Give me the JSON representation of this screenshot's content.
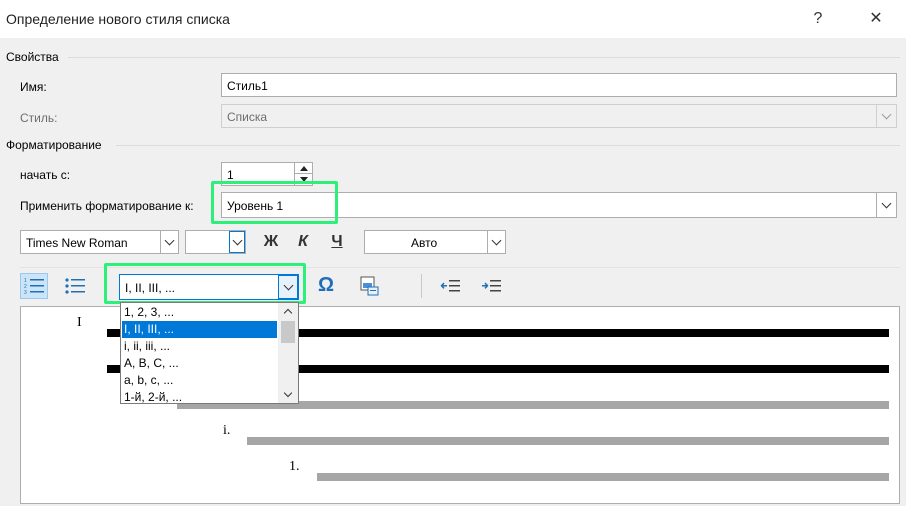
{
  "window": {
    "title": "Определение нового стиля списка",
    "help_label": "?",
    "close_label": "✕"
  },
  "properties": {
    "group_label": "Свойства",
    "name_label": "Имя:",
    "name_value": "Стиль1",
    "style_label": "Стиль:",
    "style_value": "Списка"
  },
  "formatting": {
    "group_label": "Форматирование",
    "start_label": "начать с:",
    "start_value": "1",
    "apply_label": "Применить форматирование к:",
    "apply_value": "Уровень 1",
    "font_name": "Times New Roman",
    "font_size": "",
    "bold_label": "Ж",
    "italic_label": "К",
    "underline_label": "Ч",
    "color_value": "Авто",
    "number_format_value": "I, II, III, ...",
    "symbol_label": "Ω"
  },
  "number_format_options": [
    "1, 2, 3, ...",
    "I, II, III, ...",
    "i, ii, iii, ...",
    "A, B, C, ...",
    "a, b, c, ...",
    "1-й, 2-й, ..."
  ],
  "preview": {
    "level1_marker": "I",
    "level2_marker": "i.",
    "level3_marker": "1."
  },
  "colors": {
    "highlight": "#2cf07a",
    "selection": "#0078d7",
    "accent_icon": "#1e6fb8"
  }
}
